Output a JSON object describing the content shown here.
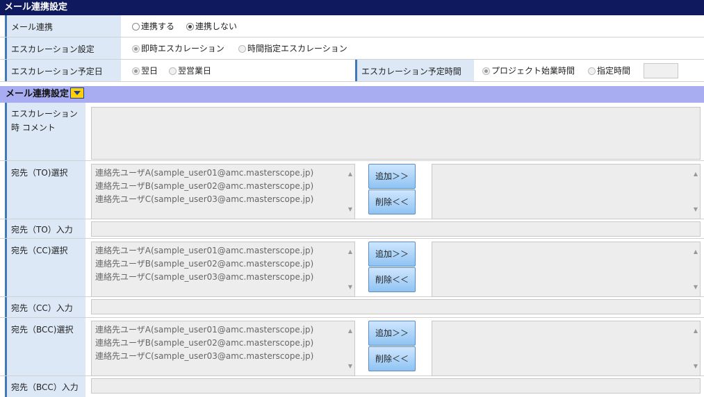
{
  "title": "メール連携設定",
  "rows": {
    "mail_link": {
      "label": "メール連携",
      "opt1": "連携する",
      "opt2": "連携しない",
      "selected": "opt2"
    },
    "escalation": {
      "label": "エスカレーション設定",
      "opt1": "即時エスカレーション",
      "opt2": "時間指定エスカレーション",
      "selected": "opt1"
    },
    "escalation_day": {
      "label": "エスカレーション予定日",
      "opt1": "翌日",
      "opt2": "翌営業日",
      "selected": "opt1"
    },
    "escalation_time": {
      "label": "エスカレーション予定時間",
      "opt1": "プロジェクト始業時間",
      "opt2": "指定時間",
      "selected": "opt1"
    }
  },
  "section": {
    "title": "メール連携設定"
  },
  "comment": {
    "label": "エスカレーション時 コメント"
  },
  "candidates": [
    "連絡先ユーザA(sample_user01@amc.masterscope.jp)",
    "連絡先ユーザB(sample_user02@amc.masterscope.jp)",
    "連絡先ユーザC(sample_user03@amc.masterscope.jp)"
  ],
  "buttons": {
    "add": "追加＞＞",
    "remove": "削除＜＜"
  },
  "to": {
    "select_label": "宛先（TO)選択",
    "input_label": "宛先（TO）入力"
  },
  "cc": {
    "select_label": "宛先（CC)選択",
    "input_label": "宛先（CC）入力"
  },
  "bcc": {
    "select_label": "宛先（BCC)選択",
    "input_label": "宛先（BCC）入力"
  }
}
